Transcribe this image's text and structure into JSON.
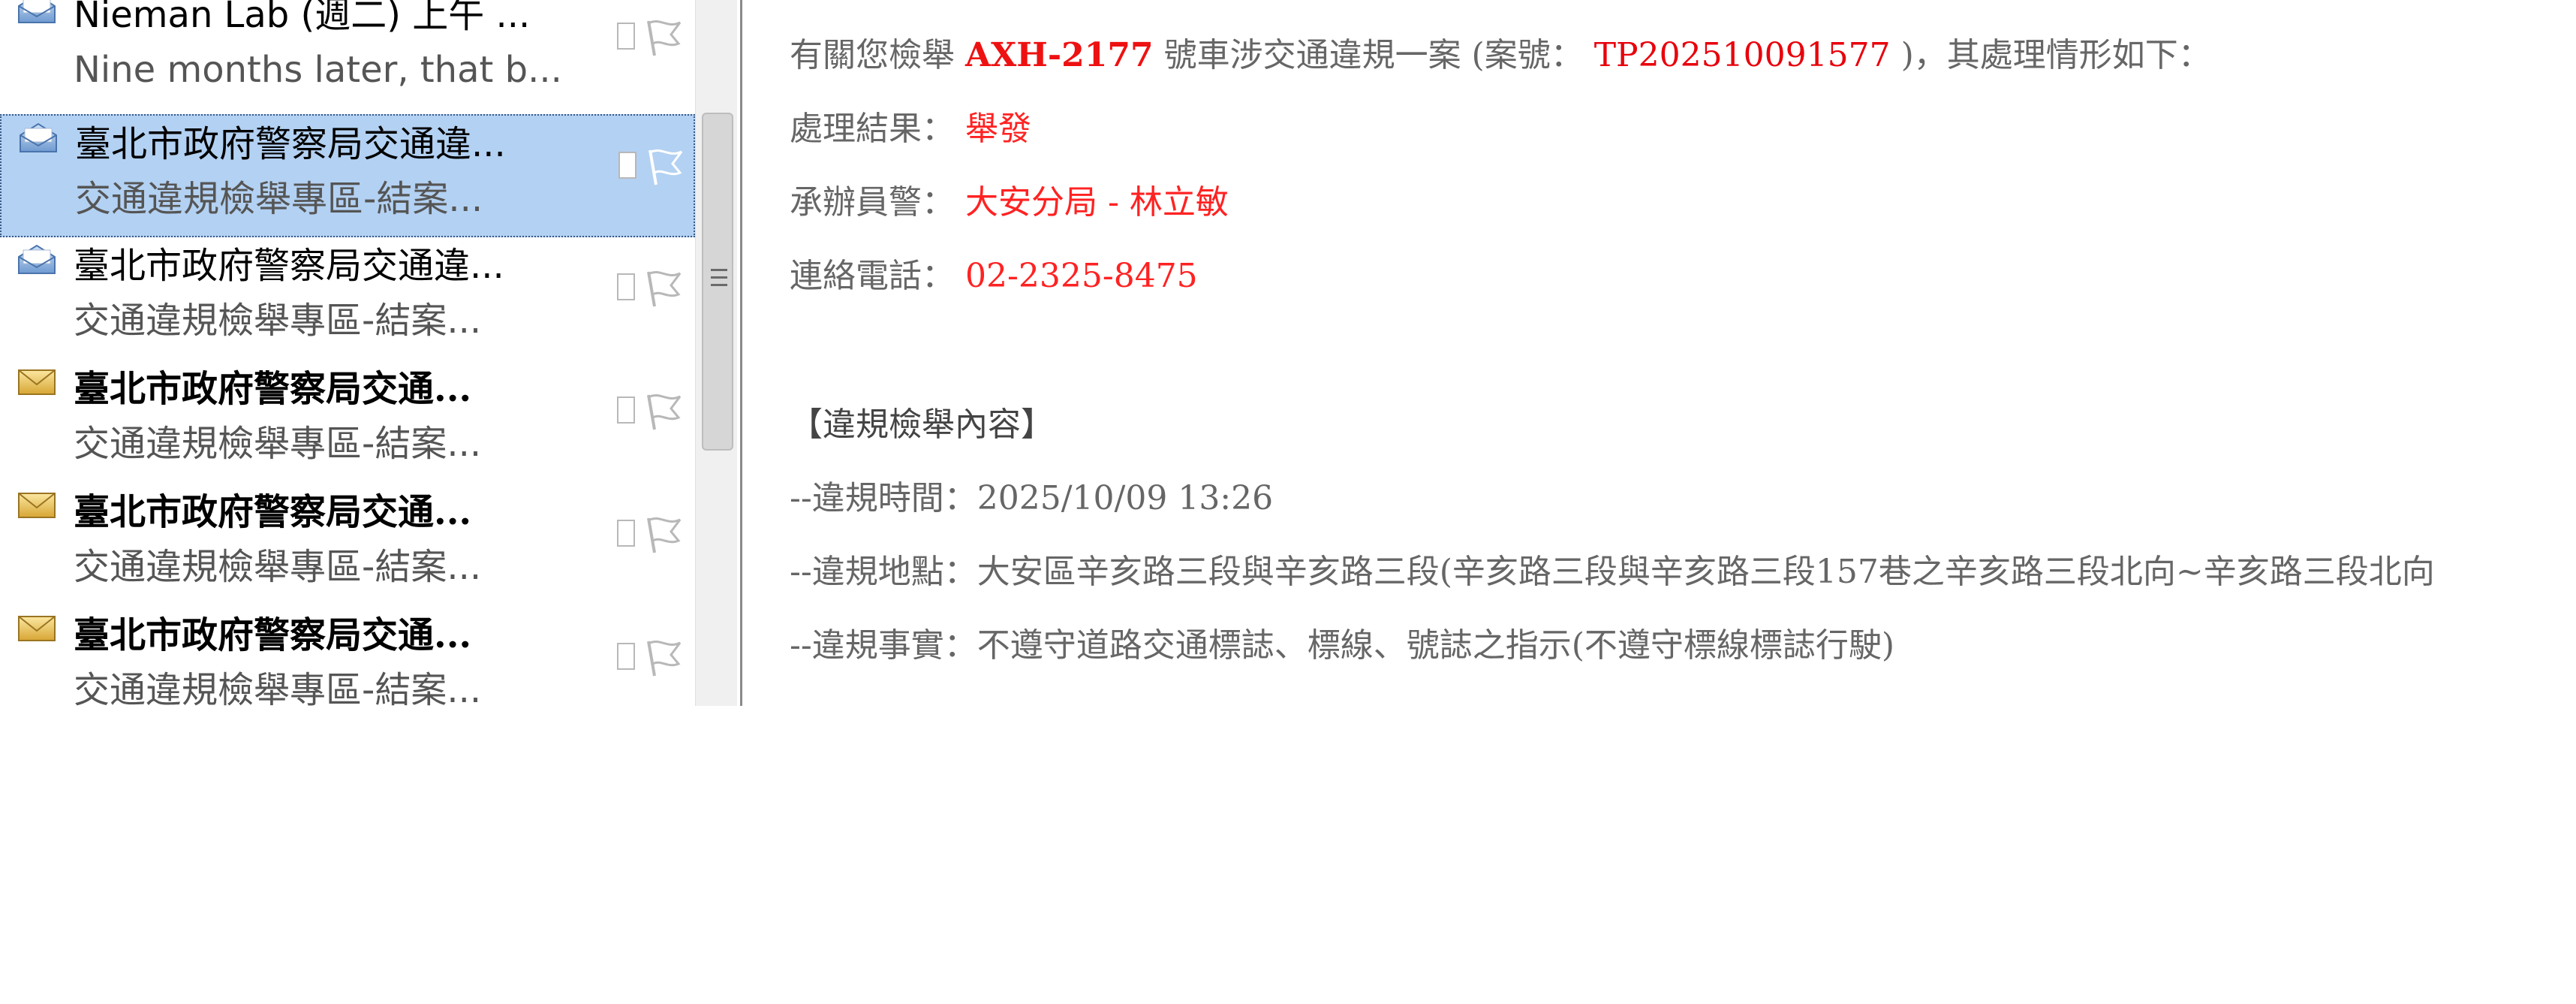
{
  "message_list": {
    "rows": [
      {
        "sender": "Nieman Lab (週二) 上午 ...",
        "preview": "Nine months later, that b...",
        "read": true
      },
      {
        "sender": "臺北市政府警察局交通違...",
        "preview": "交通違規檢舉專區-結案...",
        "read": true,
        "selected": true
      },
      {
        "sender": "臺北市政府警察局交通違...",
        "preview": "交通違規檢舉專區-結案...",
        "read": true
      },
      {
        "sender": "臺北市政府警察局交通...",
        "preview": "交通違規檢舉專區-結案...",
        "read": false
      },
      {
        "sender": "臺北市政府警察局交通...",
        "preview": "交通違規檢舉專區-結案...",
        "read": false
      },
      {
        "sender": "臺北市政府警察局交通...",
        "preview": "交通違規檢舉專區-結案...",
        "read": false
      }
    ]
  },
  "reading_pane": {
    "intro": {
      "prefix": "有關您檢舉 ",
      "plate": "AXH-2177",
      "middle": " 號車涉交通違規一案 (案號： ",
      "case_no": "TP202510091577",
      "suffix": " )，其處理情形如下："
    },
    "result": {
      "label": "處理結果： ",
      "value": "舉發"
    },
    "officer": {
      "label": "承辦員警： ",
      "value": "大安分局 - 林立敏"
    },
    "phone": {
      "label": "連絡電話： ",
      "value": "02-2325-8475"
    },
    "section_title": "【違規檢舉內容】",
    "details": [
      "--違規時間：2025/10/09 13:26",
      "--違規地點：大安區辛亥路三段與辛亥路三段(辛亥路三段與辛亥路三段157巷之辛亥路三段北向~辛亥路三段北向",
      "--違規事實：不遵守道路交通標誌、標線、號誌之指示(不遵守標線標誌行駛)"
    ]
  },
  "colors": {
    "selected_row": "#b3d1f2",
    "highlight_red": "#ff2222",
    "body_text": "#666666"
  },
  "icons": {
    "read_mail": "envelope-open-icon",
    "unread_mail": "envelope-closed-icon",
    "flag": "flag-icon",
    "checkbox": "checkbox-icon",
    "scroll_grip": "grip-icon"
  }
}
